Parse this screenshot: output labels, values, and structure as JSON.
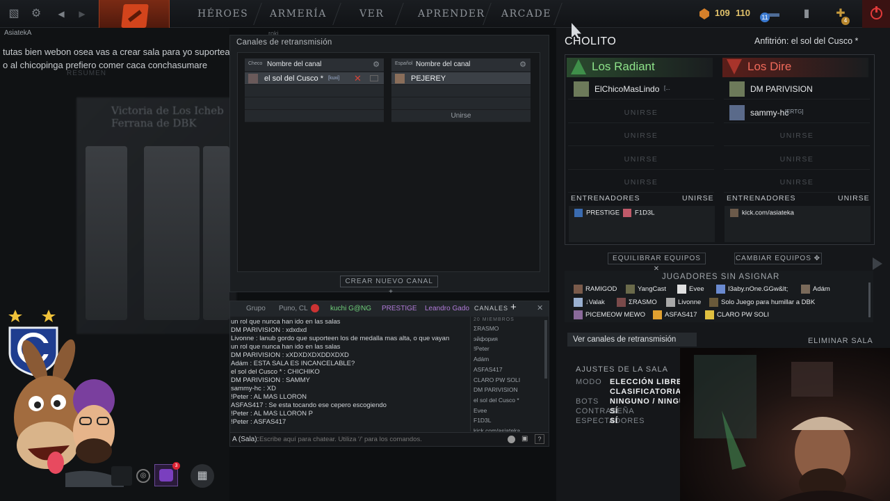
{
  "topbar": {
    "nav": [
      "HÉROES",
      "ARMERÍA",
      "VER",
      "APRENDER",
      "ARCADE"
    ],
    "res1": "109",
    "res2": "110",
    "notif_count": "11",
    "badge_count": "4"
  },
  "left": {
    "username": "AsiatekA",
    "faint_user": "roki",
    "chat": [
      "tutas bien webon osea vas a crear sala para yo suportear al fortuna",
      "o al chicopinga prefiero comer caca conchasumare"
    ],
    "blur_title": "Victoria de Los Icheb Ferrana de DBK",
    "blur_sub": "RESUMEN"
  },
  "broadcast": {
    "title": "Canales de retransmisión",
    "channels": [
      {
        "lang": "Checo",
        "name": "Nombre del canal",
        "user": "el sol del Cusco *",
        "tag": "[kuxi]",
        "join": ""
      },
      {
        "lang": "Español",
        "name": "Nombre del canal",
        "user": "PEJEREY",
        "tag": "",
        "join": "Unirse"
      }
    ],
    "new_channel": "CREAR NUEVO CANAL"
  },
  "chat": {
    "tabs": [
      "Grupo",
      "Puno, CL",
      "kuchi G@NG",
      "PRESTIGE",
      "Leandro Gado"
    ],
    "channels_label": "CANALES",
    "members_count": "20 MIEMBROS",
    "messages": [
      {
        "who": "",
        "text": "un rol que nunca han ido en las salas"
      },
      {
        "who": "DM PARIVISION",
        "text": " : xdxdxd"
      },
      {
        "who": "Livonne",
        "text": " : lanub gordo que suporteen los de medalla mas alta, o que vayan"
      },
      {
        "who": "",
        "text": "un rol que nunca han ido en las salas"
      },
      {
        "who": "DM PARIVISION",
        "text": " : xXDXDXDXDDXDXD"
      },
      {
        "who": "Adám",
        "text": " : ESTA SALA ES INCANCELABLE?"
      },
      {
        "who": "el sol del Cusco *",
        "text": " : CHICHIKO"
      },
      {
        "who": "DM PARIVISION",
        "text": " : SAMMY"
      },
      {
        "who": "sammy-hc",
        "text": " : XD"
      },
      {
        "who": "!Peter",
        "text": " : AL MAS LLORON"
      },
      {
        "who": "ASFAS417",
        "text": " : Se esta tocando ese cepero escogiendo"
      },
      {
        "who": "!Peter",
        "text": " : AL MAS LLORON P"
      },
      {
        "who": "!Peter",
        "text": " : ASFAS417"
      }
    ],
    "members": [
      "ΣRASMO",
      "эйфория",
      "!Peter",
      "Adám",
      "ASFAS417",
      "CLARO PW SOLI",
      "DM PARIVISION",
      "el sol del Cusco *",
      "Evee",
      "F1D3L",
      "kick.com/asiateka"
    ],
    "input_prefix": "A (Sala):",
    "input_placeholder": "Escribe aquí para chatear. Utiliza '/' para los comandos."
  },
  "lobby": {
    "name": "CHOLITO",
    "host": "Anfitrión: el sol del Cusco *",
    "radiant": {
      "title": "Los Radiant",
      "players": [
        "ElChicoMasLindo",
        "",
        "",
        "",
        ""
      ],
      "tags": [
        "[...",
        "",
        "",
        "",
        ""
      ]
    },
    "dire": {
      "title": "Los Dire",
      "players": [
        "DM PARIVISION",
        "sammy-hc",
        "",
        "",
        ""
      ],
      "tags": [
        "",
        "[ERTG]",
        "",
        "",
        ""
      ]
    },
    "join_label": "UNIRSE",
    "coaches_label": "ENTRENADORES",
    "radiant_coaches": [
      "PRESTIGE",
      "F1D3L"
    ],
    "dire_coaches": [
      "kick.com/asiateka"
    ],
    "balance_label": "EQUILIBRAR EQUIPOS",
    "swap_label": "CAMBIAR EQUIPOS",
    "unassigned_title": "JUGADORES SIN ASIGNAR",
    "unassigned": [
      [
        "RAMIGOD",
        "YangCast",
        "Evee",
        "I3aby.nOne.GGw&lt;",
        "Adám"
      ],
      [
        "↓Valak",
        "ΣRASMO",
        "Livonne",
        "Solo Juego para humillar a DBK"
      ],
      [
        "PICEMEOW MEWO",
        "ASFAS417",
        "CLARO PW SOLI"
      ]
    ],
    "view_channels": "Ver canales de retransmisión",
    "delete": "ELIMINAR SALA",
    "settings_title": "AJUSTES DE LA SALA",
    "settings": [
      {
        "k": "MODO",
        "v": "ELECCIÓN LIBRE"
      },
      {
        "k": "",
        "v": "CLASIFICATORIA"
      },
      {
        "k": "BOTS",
        "v": "NINGUNO / NINGU"
      },
      {
        "k": "CONTRASEÑA",
        "v": "SÍ"
      },
      {
        "k": "ESPECTADORES",
        "v": "SÍ"
      }
    ]
  },
  "colors": {
    "radiant": "#8ee38a",
    "dire": "#f06a5a",
    "accent": "#e0c16a"
  }
}
